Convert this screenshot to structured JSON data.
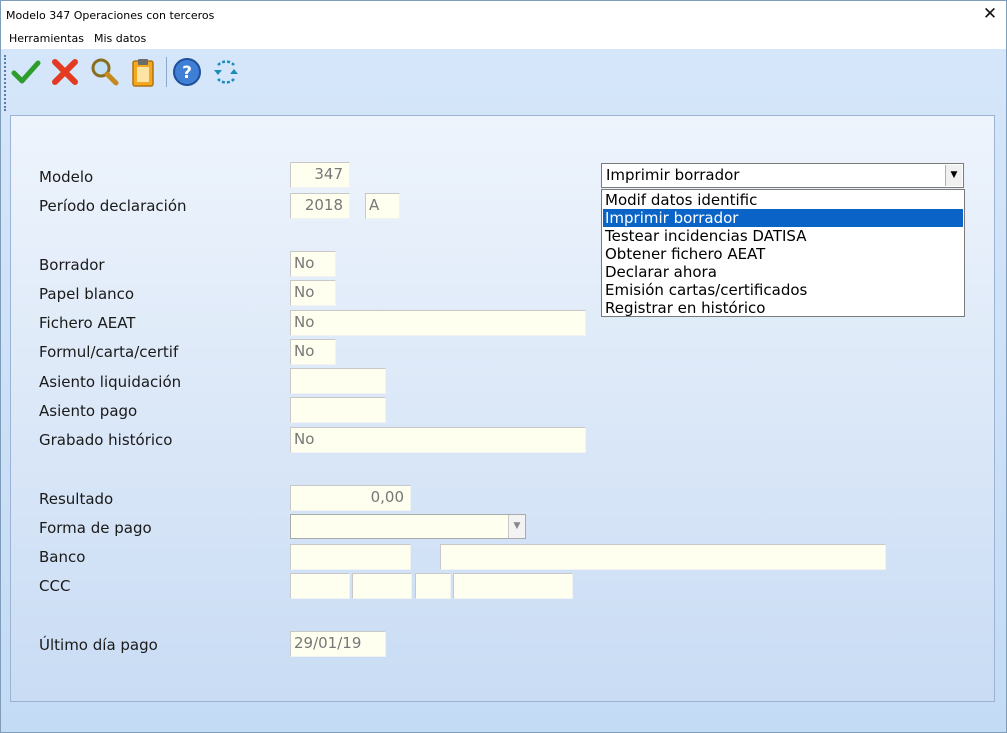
{
  "window": {
    "title": "Modelo 347 Operaciones con terceros",
    "close_label": "✕"
  },
  "menu": {
    "items": [
      "Herramientas",
      "Mis datos"
    ]
  },
  "toolbar": {
    "buttons": [
      "check-icon",
      "cancel-x-icon",
      "search-magnifier-icon",
      "clipboard-icon",
      "help-icon",
      "refresh-arrows-icon"
    ]
  },
  "form": {
    "modelo": {
      "label": "Modelo",
      "value": "347"
    },
    "periodo": {
      "label": "Período declaración",
      "year": "2018",
      "period": "A"
    },
    "borrador": {
      "label": "Borrador",
      "value": "No"
    },
    "papel_blanco": {
      "label": "Papel blanco",
      "value": "No"
    },
    "fichero_aeat": {
      "label": "Fichero AEAT",
      "value": "No"
    },
    "formul": {
      "label": "Formul/carta/certif",
      "value": "No"
    },
    "asiento_liq": {
      "label": "Asiento liquidación",
      "value": ""
    },
    "asiento_pago": {
      "label": "Asiento pago",
      "value": ""
    },
    "grabado": {
      "label": "Grabado histórico",
      "value": "No"
    },
    "resultado": {
      "label": "Resultado",
      "value": "0,00"
    },
    "forma_pago": {
      "label": "Forma de pago",
      "value": ""
    },
    "banco": {
      "label": "Banco",
      "code": "",
      "name": ""
    },
    "ccc": {
      "label": "CCC",
      "parts": [
        "",
        "",
        "",
        ""
      ]
    },
    "ultimo_dia": {
      "label": "Último día pago",
      "value": "29/01/19"
    }
  },
  "action_dropdown": {
    "selected": "Imprimir borrador",
    "arrow": "▼",
    "options": [
      "Modif datos identific",
      "Imprimir borrador",
      "Testear incidencias DATISA",
      "Obtener fichero AEAT",
      "Declarar ahora",
      "Emisión cartas/certificados",
      "Registrar en histórico"
    ],
    "highlighted_index": 1
  },
  "colors": {
    "highlight": "#0a64c8",
    "field_bg": "#fffff0",
    "panel_bg": "#dbe8f8"
  }
}
